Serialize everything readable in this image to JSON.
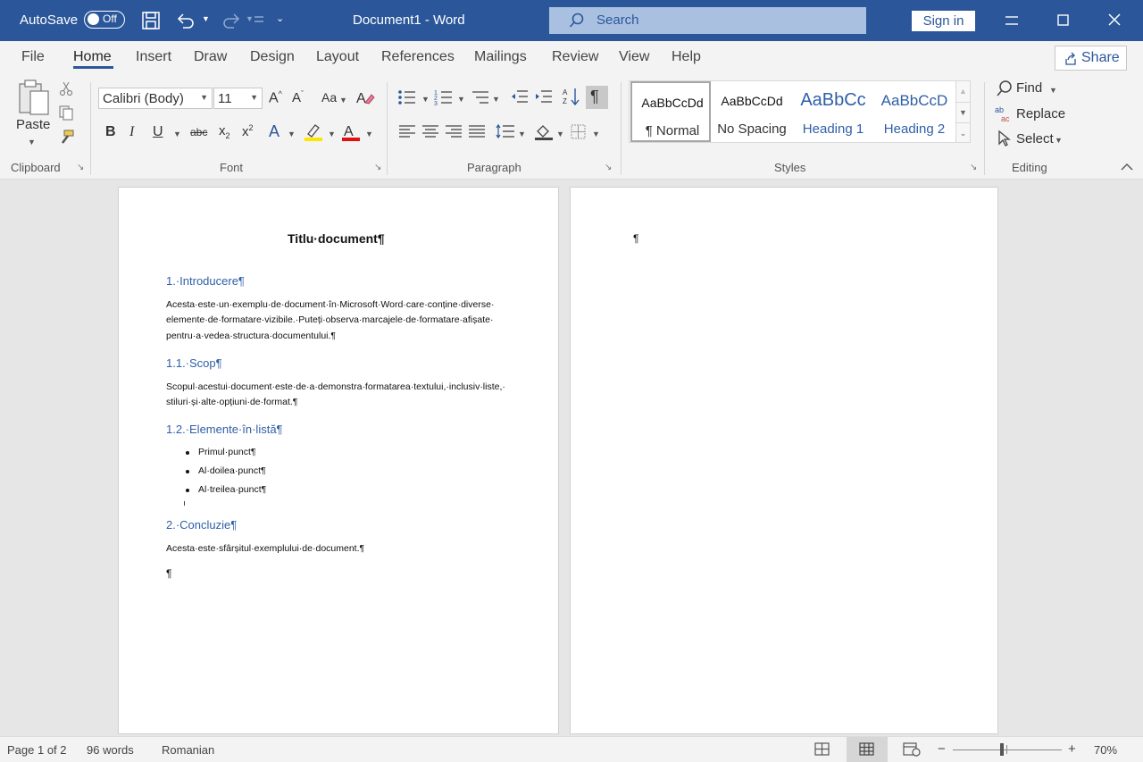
{
  "titlebar": {
    "autosave_label": "AutoSave",
    "autosave_state": "Off",
    "doc_title": "Document1 - Word",
    "search_placeholder": "Search",
    "signin_label": "Sign in"
  },
  "tabs": [
    "File",
    "Home",
    "Insert",
    "Draw",
    "Design",
    "Layout",
    "References",
    "Mailings",
    "Review",
    "View",
    "Help"
  ],
  "active_tab": "Home",
  "share_label": "Share",
  "ribbon": {
    "clipboard": {
      "paste_label": "Paste",
      "group_label": "Clipboard"
    },
    "font": {
      "font_name": "Calibri (Body)",
      "font_size": "11",
      "group_label": "Font"
    },
    "paragraph": {
      "group_label": "Paragraph"
    },
    "styles": {
      "group_label": "Styles",
      "items": [
        {
          "preview": "AaBbCcDd",
          "name": "¶ Normal"
        },
        {
          "preview": "AaBbCcDd",
          "name": "No Spacing"
        },
        {
          "preview": "AaBbCc",
          "name": "Heading 1"
        },
        {
          "preview": "AaBbCcD",
          "name": "Heading 2"
        }
      ]
    },
    "editing": {
      "find_label": "Find",
      "replace_label": "Replace",
      "select_label": "Select",
      "group_label": "Editing"
    }
  },
  "document": {
    "title": "Titlu·document¶",
    "h1_intro": "1.·Introducere¶",
    "p_intro_1": "Acesta·este·un·exemplu·de·document·în·Microsoft·Word·care·conține·diverse·",
    "p_intro_2": "elemente·de·formatare·vizibile.·Puteți·observa·marcajele·de·formatare·afișate·",
    "p_intro_3": "pentru·a·vedea·structura·documentului.¶",
    "h2_scope": "1.1.·Scop¶",
    "p_scope_1": "Scopul·acestui·document·este·de·a·demonstra·formatarea·textului,·inclusiv·liste,·",
    "p_scope_2": "stiluri·și·alte·opțiuni·de·format.¶",
    "h2_list": "1.2.·Elemente·în·listă¶",
    "bullets": [
      "Primul·punct¶",
      "Al·doilea·punct¶",
      "Al·treilea·punct¶"
    ],
    "h1_concl": "2.·Concluzie¶",
    "p_concl": "Acesta·este·sfârșitul·exemplului·de·document.¶",
    "empty_mark": "¶",
    "page2_mark": "¶"
  },
  "status": {
    "page": "Page 1 of 2",
    "words": "96 words",
    "language": "Romanian",
    "zoom": "70%",
    "zoom_fraction": 0.45
  },
  "colors": {
    "brand": "#2b579a",
    "heading": "#2f5fa8"
  }
}
